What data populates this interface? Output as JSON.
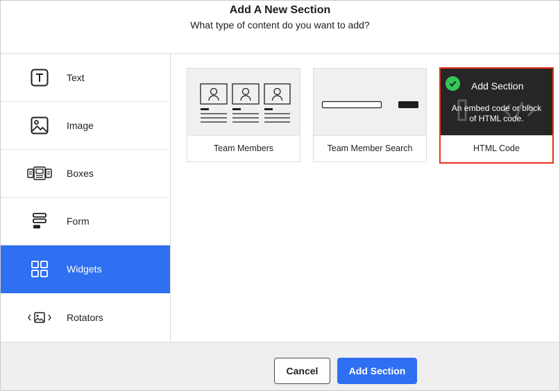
{
  "header": {
    "title": "Add A New Section",
    "subtitle": "What type of content do you want to add?"
  },
  "sidebar": {
    "items": [
      {
        "label": "Text",
        "icon": "text-icon"
      },
      {
        "label": "Image",
        "icon": "image-icon"
      },
      {
        "label": "Boxes",
        "icon": "boxes-icon"
      },
      {
        "label": "Form",
        "icon": "form-icon"
      },
      {
        "label": "Widgets",
        "icon": "widgets-icon",
        "active": true
      },
      {
        "label": "Rotators",
        "icon": "rotators-icon"
      }
    ]
  },
  "widgets": {
    "cards": [
      {
        "label": "Team Members"
      },
      {
        "label": "Team Member Search"
      },
      {
        "label": "HTML Code",
        "selected": true,
        "overlay_title": "Add Section",
        "overlay_desc": "An embed code or block of HTML code."
      }
    ]
  },
  "footer": {
    "cancel_label": "Cancel",
    "add_label": "Add Section"
  },
  "colors": {
    "accent": "#2f6ff1",
    "selected_border": "#e8321a",
    "check": "#34c759"
  }
}
